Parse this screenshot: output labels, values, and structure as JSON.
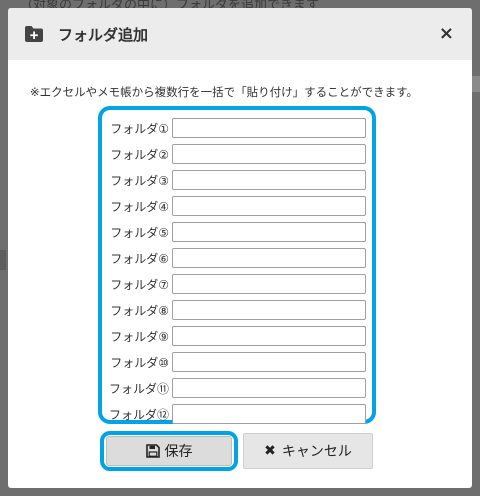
{
  "background": {
    "partial_text": "（対象のフォルダの中に）フォルダを追加できます"
  },
  "dialog": {
    "title": "フォルダ追加",
    "close_label": "×",
    "note": "※エクセルやメモ帳から複数行を一括で「貼り付け」することができます。",
    "folders": [
      {
        "label": "フォルダ①",
        "value": ""
      },
      {
        "label": "フォルダ②",
        "value": ""
      },
      {
        "label": "フォルダ③",
        "value": ""
      },
      {
        "label": "フォルダ④",
        "value": ""
      },
      {
        "label": "フォルダ⑤",
        "value": ""
      },
      {
        "label": "フォルダ⑥",
        "value": ""
      },
      {
        "label": "フォルダ⑦",
        "value": ""
      },
      {
        "label": "フォルダ⑧",
        "value": ""
      },
      {
        "label": "フォルダ⑨",
        "value": ""
      },
      {
        "label": "フォルダ⑩",
        "value": ""
      },
      {
        "label": "フォルダ⑪",
        "value": ""
      },
      {
        "label": "フォルダ⑫",
        "value": ""
      }
    ],
    "save_label": "保存",
    "cancel_label": "キャンセル",
    "icons": {
      "title": "folder-plus-icon",
      "close": "close-icon",
      "save": "save-icon",
      "cancel": "x-icon"
    }
  },
  "colors": {
    "highlight": "#00a3e6",
    "header_bg": "#ececec",
    "overlay": "#6e6e6e"
  }
}
